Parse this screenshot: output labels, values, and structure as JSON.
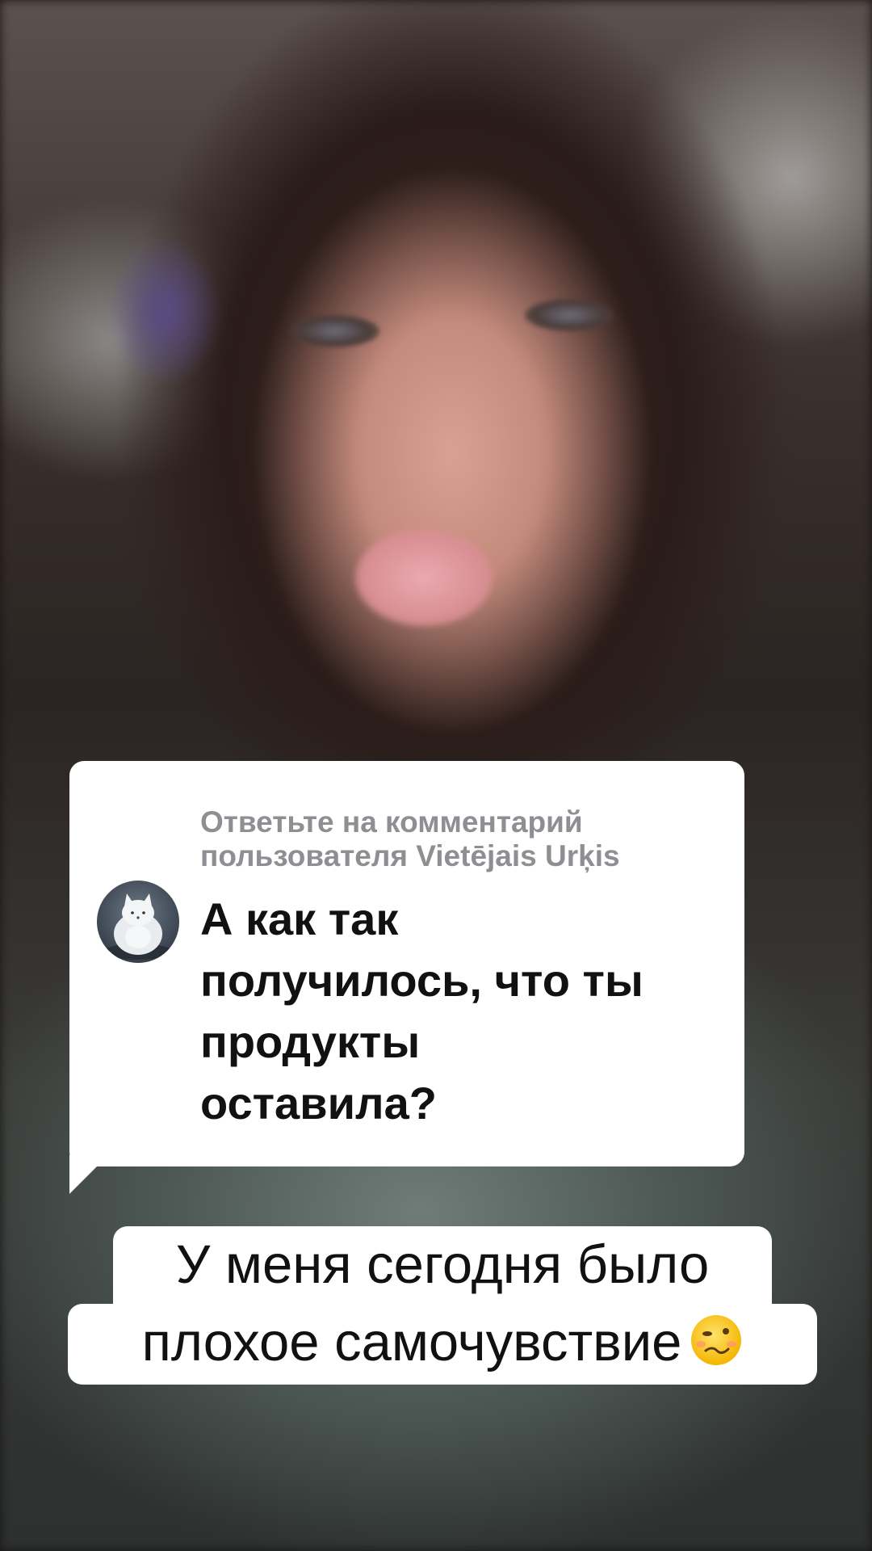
{
  "reply_card": {
    "header_line1": "Ответьте на комментарий",
    "header_line2": "пользователя Vietējais Urķis",
    "avatar_icon": "white-fox-avatar-icon",
    "comment_lines": [
      "А как так",
      "получилось, что ты",
      "продукты",
      "оставила?"
    ]
  },
  "caption": {
    "line1": "У меня сегодня было",
    "line2": "плохое самочувствие",
    "emoji_icon": "woozy-face-emoji-icon"
  },
  "colors": {
    "card_bg": "#ffffff",
    "header_text": "#8e8e93",
    "comment_text": "#111111",
    "caption_bg": "#ffffff"
  }
}
